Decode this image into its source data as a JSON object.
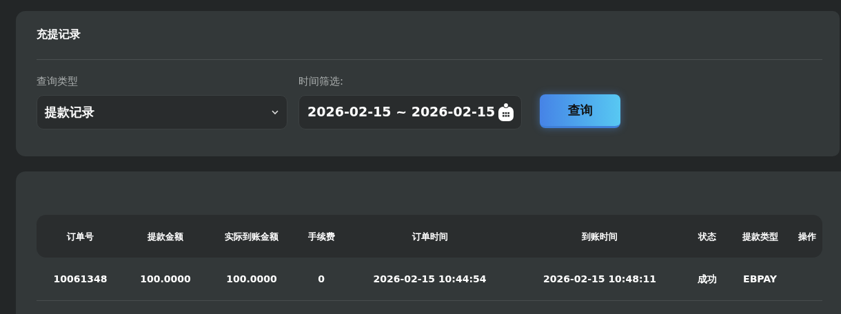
{
  "filter_panel": {
    "title": "充提记录",
    "type_label": "查询类型",
    "type_select": {
      "value": "提款记录"
    },
    "date_label": "时间筛选:",
    "date_range": {
      "value": "2026-02-15 ~ 2026-02-15"
    },
    "query_button": "查询"
  },
  "table": {
    "columns": [
      "订单号",
      "提款金额",
      "实际到账金额",
      "手续费",
      "订单时间",
      "到账时间",
      "状态",
      "提款类型",
      "操作"
    ],
    "rows": [
      {
        "cells": [
          "10061348",
          "100.0000",
          "100.0000",
          "0",
          "2026-02-15 10:44:54",
          "2026-02-15 10:48:11",
          "成功",
          "EBPAY"
        ]
      }
    ]
  }
}
